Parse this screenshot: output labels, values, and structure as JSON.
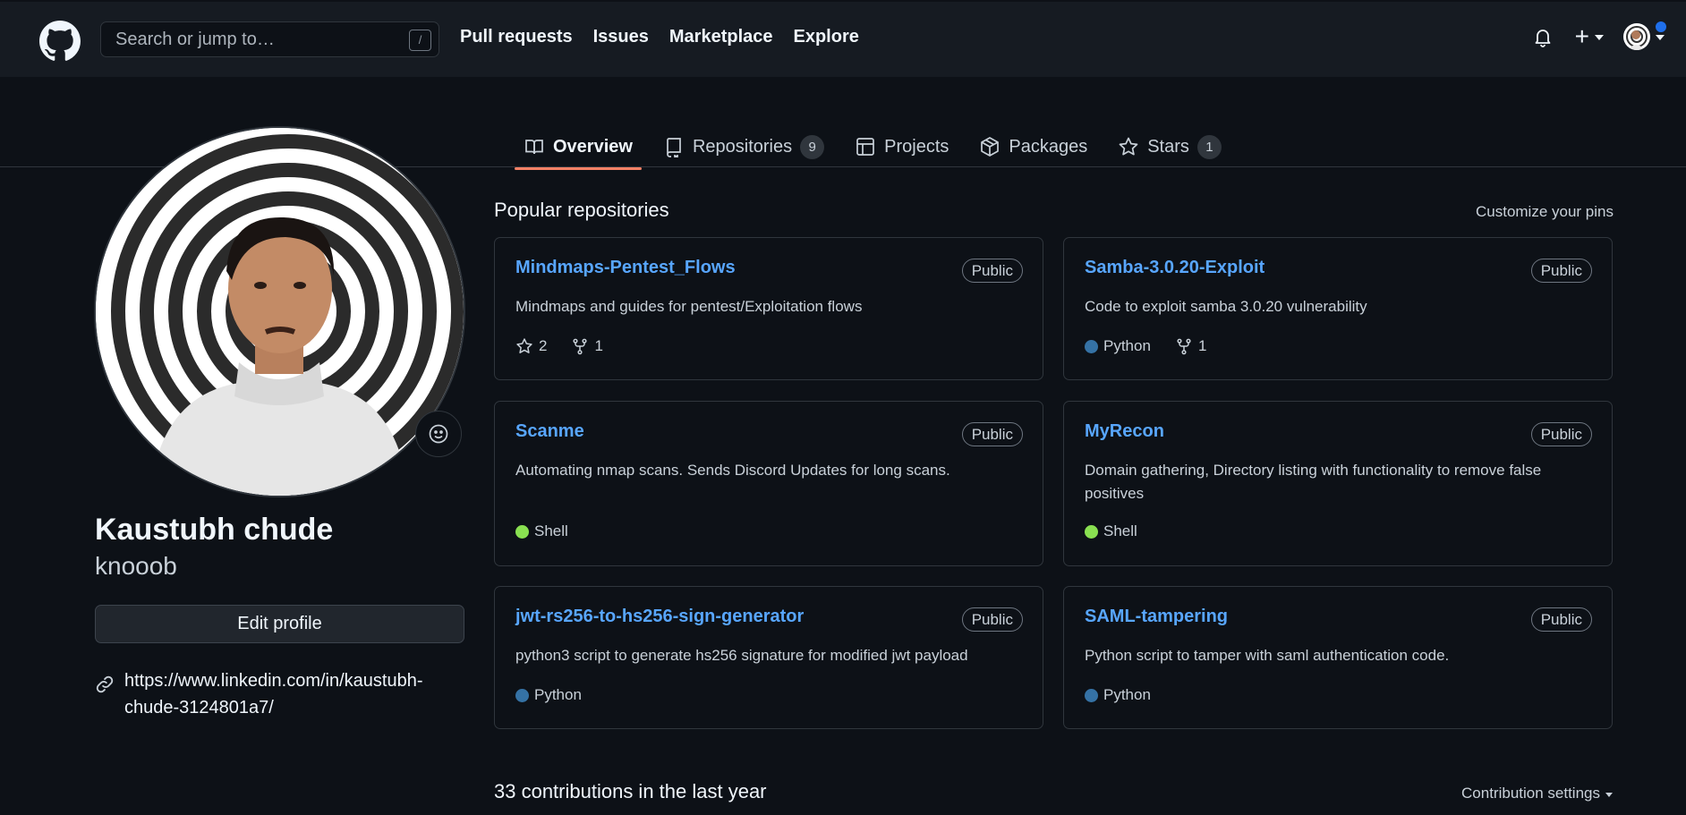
{
  "header": {
    "search_placeholder": "Search or jump to…",
    "search_shortcut": "/",
    "nav": [
      "Pull requests",
      "Issues",
      "Marketplace",
      "Explore"
    ],
    "create_label": "+"
  },
  "tabs": [
    {
      "label": "Overview",
      "icon": "book-icon",
      "active": true
    },
    {
      "label": "Repositories",
      "icon": "repo-icon",
      "count": "9"
    },
    {
      "label": "Projects",
      "icon": "table-icon"
    },
    {
      "label": "Packages",
      "icon": "package-icon"
    },
    {
      "label": "Stars",
      "icon": "star-icon",
      "count": "1"
    }
  ],
  "profile": {
    "full_name": "Kaustubh chude",
    "username": "knooob",
    "edit_label": "Edit profile",
    "website": "https://www.linkedin.com/in/kaustubh-chude-3124801a7/"
  },
  "popular": {
    "title": "Popular repositories",
    "customize_label": "Customize your pins",
    "repos": [
      {
        "name": "Mindmaps-Pentest_Flows",
        "visibility": "Public",
        "description": "Mindmaps and guides for pentest/Exploitation flows",
        "stars": "2",
        "forks": "1",
        "language": "",
        "lang_color": ""
      },
      {
        "name": "Samba-3.0.20-Exploit",
        "visibility": "Public",
        "description": "Code to exploit samba 3.0.20 vulnerability",
        "language": "Python",
        "lang_color": "#3572A5",
        "forks": "1"
      },
      {
        "name": "Scanme",
        "visibility": "Public",
        "description": "Automating nmap scans. Sends Discord Updates for long scans.",
        "language": "Shell",
        "lang_color": "#89e051"
      },
      {
        "name": "MyRecon",
        "visibility": "Public",
        "description": "Domain gathering, Directory listing with functionality to remove false positives",
        "language": "Shell",
        "lang_color": "#89e051"
      },
      {
        "name": "jwt-rs256-to-hs256-sign-generator",
        "visibility": "Public",
        "description": "python3 script to generate hs256 signature for modified jwt payload",
        "language": "Python",
        "lang_color": "#3572A5"
      },
      {
        "name": "SAML-tampering",
        "visibility": "Public",
        "description": "Python script to tamper with saml authentication code.",
        "language": "Python",
        "lang_color": "#3572A5"
      }
    ]
  },
  "contributions": {
    "title": "33 contributions in the last year",
    "settings_label": "Contribution settings"
  },
  "colors": {
    "background": "#0d1117",
    "header": "#161b22",
    "link": "#58a6ff",
    "tab_underline": "#f78166"
  }
}
